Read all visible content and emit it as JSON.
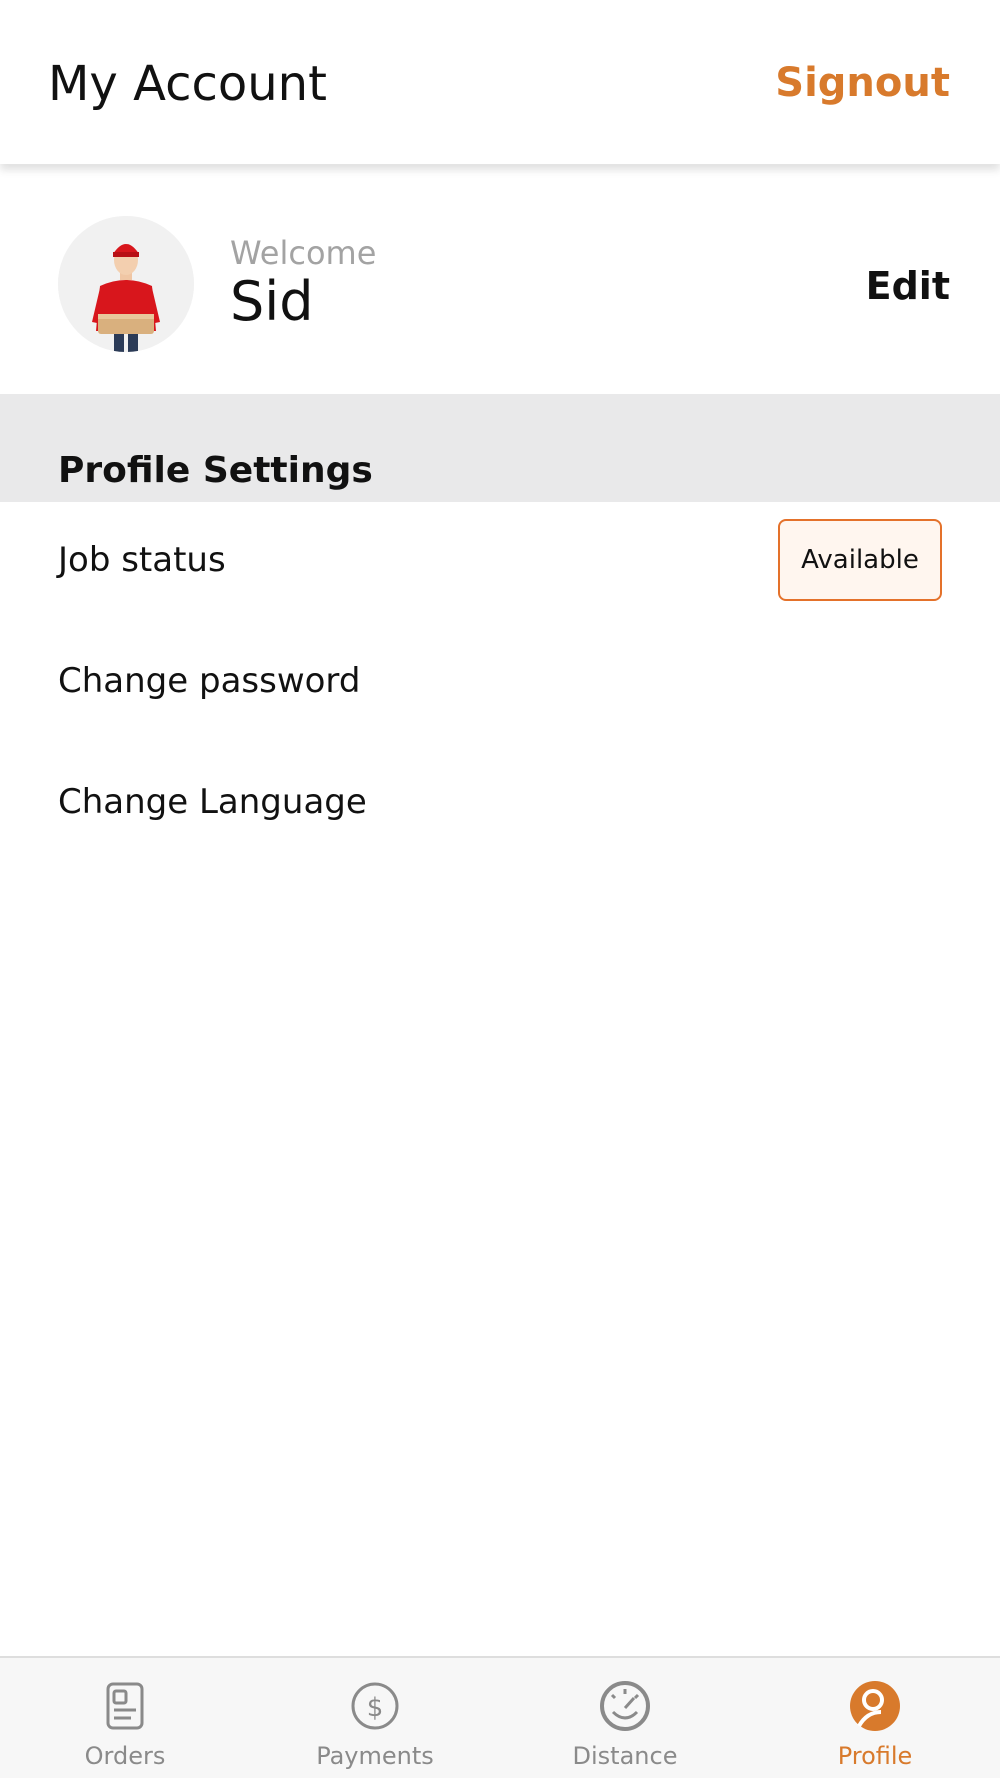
{
  "header": {
    "title": "My Account",
    "signout_label": "Signout"
  },
  "profile": {
    "welcome_label": "Welcome",
    "name": "Sid",
    "edit_label": "Edit"
  },
  "settings": {
    "section_title": "Profile Settings",
    "job_status_label": "Job status",
    "job_status_value": "Available",
    "change_password_label": "Change password",
    "change_language_label": "Change Language"
  },
  "tabs": [
    {
      "label": "Orders",
      "icon": "orders-icon"
    },
    {
      "label": "Payments",
      "icon": "payments-icon"
    },
    {
      "label": "Distance",
      "icon": "distance-icon"
    },
    {
      "label": "Profile",
      "icon": "profile-icon",
      "active": true
    }
  ],
  "colors": {
    "accent": "#d87a2c",
    "badge_border": "#e4712a",
    "section_bg": "#e9e9ea"
  }
}
